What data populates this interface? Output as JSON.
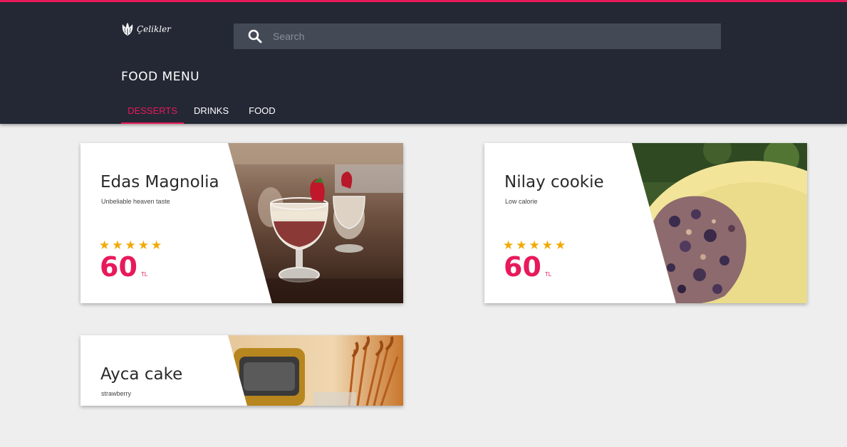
{
  "header": {
    "logo_text": "Çelikler",
    "search_placeholder": "Search",
    "menu_title": "FOOD MENU",
    "tabs": [
      {
        "label": "DESSERTS",
        "active": true
      },
      {
        "label": "DRINKS",
        "active": false
      },
      {
        "label": "FOOD",
        "active": false
      }
    ]
  },
  "colors": {
    "header_bg": "#242835",
    "accent": "#e8195a",
    "star": "#f2a900",
    "page_bg": "#eeeeee"
  },
  "items": [
    {
      "name": "Edas Magnolia",
      "description": "Unbeliable heaven taste",
      "rating": 5,
      "stars": "★★★★★",
      "price": "60",
      "currency": "TL"
    },
    {
      "name": "Nilay cookie",
      "description": "Low calorie",
      "rating": 5,
      "stars": "★★★★★",
      "price": "60",
      "currency": "TL"
    },
    {
      "name": "Ayca cake",
      "description": "strawberry"
    }
  ]
}
